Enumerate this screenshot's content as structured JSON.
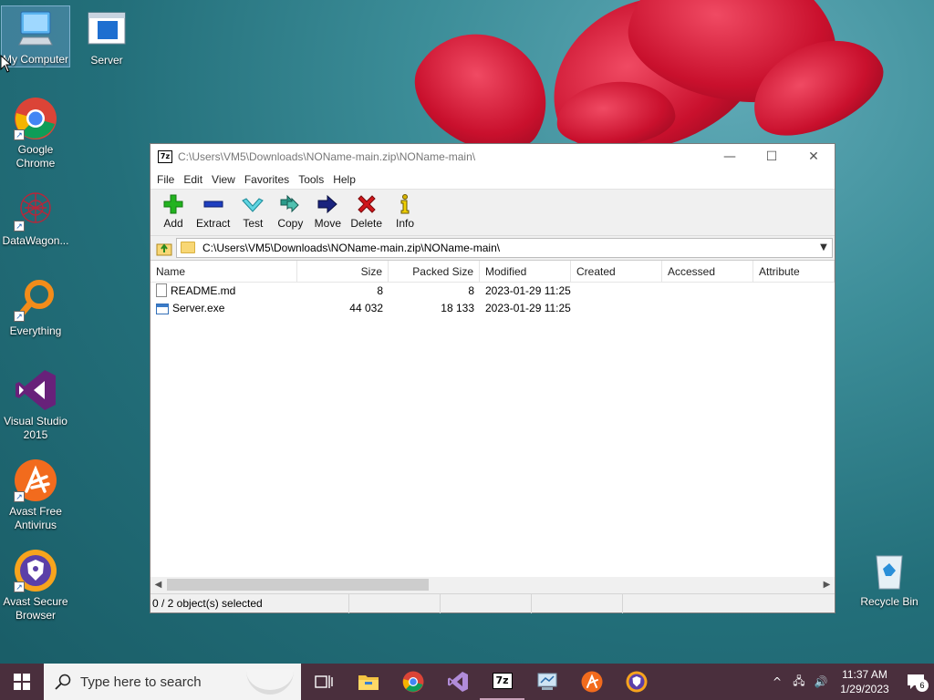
{
  "desktop": {
    "icons": [
      {
        "label": "My Computer"
      },
      {
        "label": "Server"
      },
      {
        "label": "Google Chrome"
      },
      {
        "label": "DataWagon..."
      },
      {
        "label": "Everything"
      },
      {
        "label": "Visual Studio 2015"
      },
      {
        "label": "Avast Free Antivirus"
      },
      {
        "label": "Avast Secure Browser"
      },
      {
        "label": "Recycle Bin"
      }
    ]
  },
  "window": {
    "app_icon_text": "7z",
    "title": "C:\\Users\\VM5\\Downloads\\NOName-main.zip\\NOName-main\\",
    "controls": {
      "minimize": "—",
      "maximize": "☐",
      "close": "✕"
    },
    "menu": [
      "File",
      "Edit",
      "View",
      "Favorites",
      "Tools",
      "Help"
    ],
    "toolbar": [
      {
        "label": "Add",
        "icon": "plus-icon",
        "color": "#22b31f"
      },
      {
        "label": "Extract",
        "icon": "minus-icon",
        "color": "#1f3fc0"
      },
      {
        "label": "Test",
        "icon": "check-icon",
        "color": "#2fb6c7"
      },
      {
        "label": "Copy",
        "icon": "double-arrow-icon",
        "color": "#2a9a8a"
      },
      {
        "label": "Move",
        "icon": "arrow-right-icon",
        "color": "#1a237e"
      },
      {
        "label": "Delete",
        "icon": "x-icon",
        "color": "#d0161a"
      },
      {
        "label": "Info",
        "icon": "info-icon",
        "color": "#d8b400"
      }
    ],
    "address": "C:\\Users\\VM5\\Downloads\\NOName-main.zip\\NOName-main\\",
    "columns": [
      "Name",
      "Size",
      "Packed Size",
      "Modified",
      "Created",
      "Accessed",
      "Attribute"
    ],
    "files": [
      {
        "name": "README.md",
        "size": "8",
        "packed": "8",
        "modified": "2023-01-29 11:25",
        "created": "",
        "accessed": "",
        "attr": "",
        "type": "file"
      },
      {
        "name": "Server.exe",
        "size": "44 032",
        "packed": "18 133",
        "modified": "2023-01-29 11:25",
        "created": "",
        "accessed": "",
        "attr": "",
        "type": "exe"
      }
    ],
    "status": "0 / 2 object(s) selected"
  },
  "taskbar": {
    "search_placeholder": "Type here to search",
    "apps": [
      "task-view-icon",
      "file-explorer-icon",
      "chrome-icon",
      "visual-studio-icon",
      "7zip-icon",
      "network-app-icon",
      "avast-icon",
      "avast-browser-icon"
    ],
    "app_7z_text": "7z",
    "time": "11:37 AM",
    "date": "1/29/2023",
    "notification_count": "6",
    "tray": {
      "chevron": "^",
      "network": "🖧",
      "volume": "🔊"
    }
  }
}
